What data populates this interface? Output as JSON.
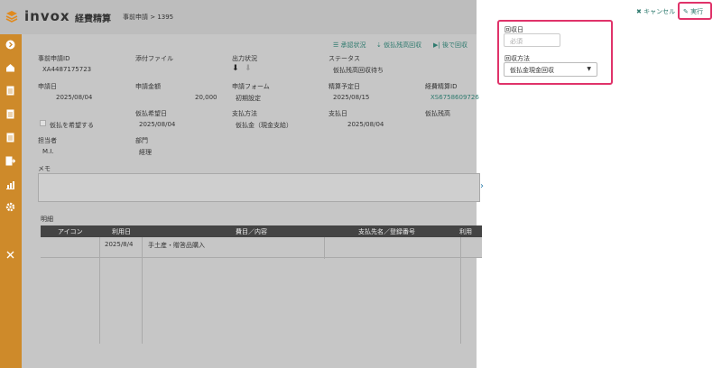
{
  "header": {
    "logo": "invox",
    "app_name": "経費精算",
    "breadcrumb": "事前申請 > 1395"
  },
  "actions": {
    "approval_status": "承認状況",
    "advance_collection": "仮払残高回収",
    "later_collection": "後で回収"
  },
  "details": {
    "request_id_label": "事前申請ID",
    "request_id": "XA4487175723",
    "attachment_label": "添付ファイル",
    "output_label": "出力状況",
    "status_label": "ステータス",
    "status": "仮払残高回収待ち",
    "request_date_label": "申請日",
    "request_date": "2025/08/04",
    "amount_label": "申請金額",
    "amount": "20,000",
    "form_label": "申請フォーム",
    "form": "初期設定",
    "settle_date_label": "精算予定日",
    "settle_date": "2025/08/15",
    "expense_id_label": "経費精算ID",
    "expense_id": "XS6758609726",
    "advance_hope_date_label": "仮払希望日",
    "advance_hope_date": "2025/08/04",
    "payment_method_label": "支払方法",
    "payment_method": "仮払金（現金支給）",
    "payment_date_label": "支払日",
    "payment_date": "2025/08/04",
    "advance_balance_label": "仮払残高",
    "want_advance": "仮払を希望する",
    "person_label": "担当者",
    "person": "M.I.",
    "dept_label": "部門",
    "dept": "経理",
    "memo_label": "メモ"
  },
  "table": {
    "title": "明細",
    "headers": [
      "アイコン",
      "利用日",
      "費目／内容",
      "支払先名／登録番号",
      "利用"
    ],
    "rows": [
      {
        "date": "2025/8/4",
        "content": "手土産・贈答品購入"
      }
    ]
  },
  "panel": {
    "cancel": "キャンセル",
    "execute": "実行",
    "collect_date_label": "回収日",
    "collect_date_placeholder": "必須",
    "collect_method_label": "回収方法",
    "collect_method_value": "仮払金現金回収"
  },
  "colors": {
    "sidebar": "#ce8a2a",
    "accent": "#2e7a6e",
    "highlight": "#e0336a"
  }
}
